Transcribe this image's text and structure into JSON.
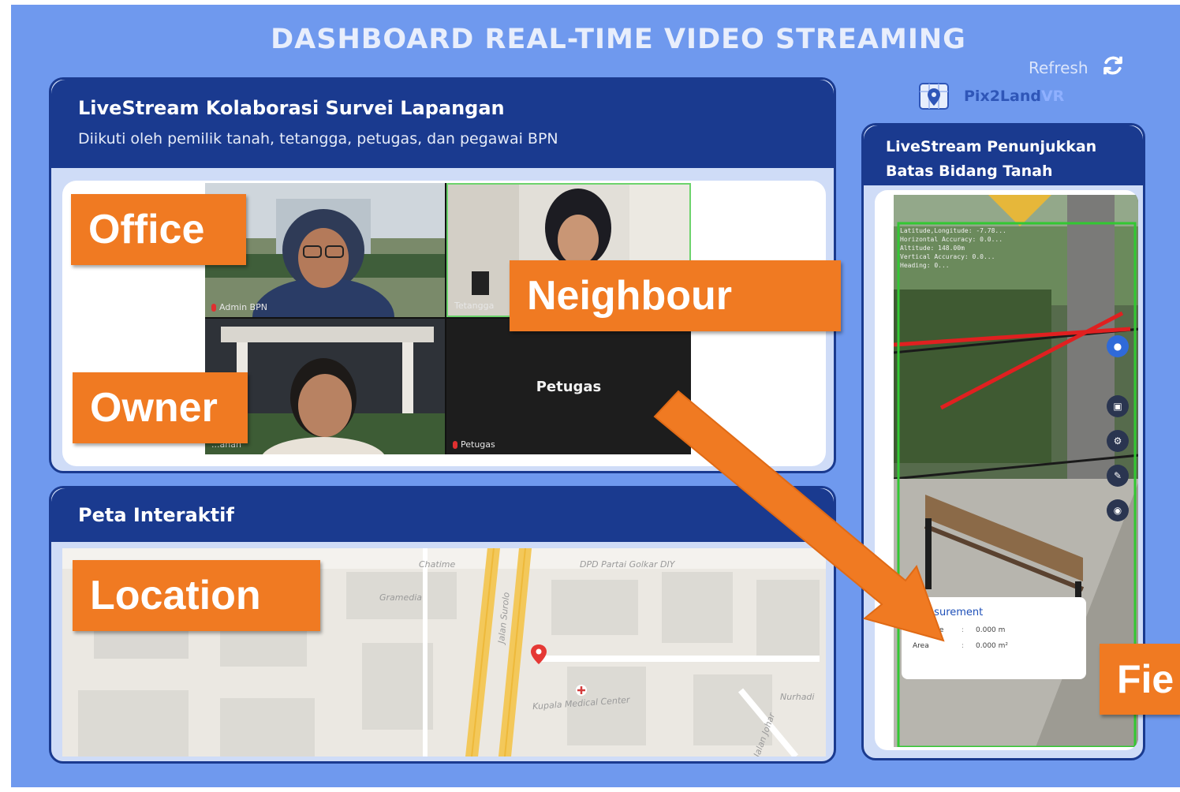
{
  "header": {
    "title": "DASHBOARD REAL-TIME VIDEO STREAMING",
    "refresh_label": "Refresh",
    "brand_name_part1": "Pix2Land",
    "brand_name_part2": "VR"
  },
  "livestream_panel": {
    "title": "LiveStream Kolaborasi Survei Lapangan",
    "subtitle": "Diikuti oleh pemilik tanah, tetangga, petugas, dan pegawai BPN",
    "tiles": {
      "admin": "Admin BPN",
      "tetangga": "Tetangga",
      "owner": "...anah",
      "petugas_name": "Petugas",
      "petugas_label": "Petugas"
    }
  },
  "map_panel": {
    "title": "Peta Interaktif",
    "labels": {
      "chatime": "Chatime",
      "gramedia": "Gramedia",
      "dpd": "DPD Partai Golkar DIY",
      "jalan": "Jalan Surolo",
      "kupala": "Kupala Medical Center",
      "nurhadi": "Nurhadi",
      "jalan2": "Jalan Johar"
    }
  },
  "field_panel": {
    "title_line1": "LiveStream Penunjukkan",
    "title_line2": "Batas Bidang Tanah",
    "overlay": [
      "Latitude,Longitude: -7.78...",
      "Horizontal Accuracy: 0.0...",
      "Altitude: 148.00m",
      "Vertical Accuracy: 0.0...",
      "Heading: 0..."
    ],
    "measurement": {
      "title": "Measurement",
      "distance_label": "Distance",
      "distance_value": "0.000 m",
      "area_label": "Area",
      "area_value": "0.000 m²"
    }
  },
  "annotations": {
    "office": "Office",
    "neighbour": "Neighbour",
    "owner": "Owner",
    "location": "Location",
    "field": "Fie"
  },
  "colors": {
    "background": "#6f99ee",
    "panel_header": "#1a3a8f",
    "annotation": "#f07a22",
    "arrow": "#f07a22"
  }
}
